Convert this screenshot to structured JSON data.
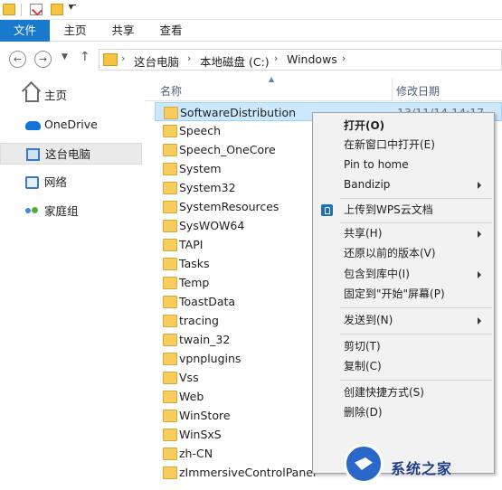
{
  "ribbon": {
    "tabs": [
      {
        "label": "文件"
      },
      {
        "label": "主页"
      },
      {
        "label": "共享"
      },
      {
        "label": "查看"
      }
    ]
  },
  "address": {
    "crumbs": [
      "这台电脑",
      "本地磁盘 (C:)",
      "Windows"
    ]
  },
  "navpane": {
    "items": [
      {
        "label": "主页",
        "icon": "home-icon"
      },
      {
        "label": "OneDrive",
        "icon": "onedrive-icon"
      },
      {
        "label": "这台电脑",
        "icon": "computer-icon",
        "selected": true
      },
      {
        "label": "网络",
        "icon": "network-icon"
      },
      {
        "label": "家庭组",
        "icon": "homegroup-icon"
      }
    ]
  },
  "filelist": {
    "headers": {
      "name": "名称",
      "date": "修改日期"
    },
    "rows": [
      {
        "name": "SoftwareDistribution",
        "date": "13/11/14 14:17",
        "selected": true
      },
      {
        "name": "Speech"
      },
      {
        "name": "Speech_OneCore"
      },
      {
        "name": "System"
      },
      {
        "name": "System32"
      },
      {
        "name": "SystemResources"
      },
      {
        "name": "SysWOW64"
      },
      {
        "name": "TAPI"
      },
      {
        "name": "Tasks"
      },
      {
        "name": "Temp"
      },
      {
        "name": "ToastData"
      },
      {
        "name": "tracing"
      },
      {
        "name": "twain_32"
      },
      {
        "name": "vpnplugins"
      },
      {
        "name": "Vss"
      },
      {
        "name": "Web"
      },
      {
        "name": "WinStore"
      },
      {
        "name": "WinSxS"
      },
      {
        "name": "zh-CN"
      },
      {
        "name": "zImmersiveControlPanel"
      }
    ]
  },
  "contextmenu": {
    "items": [
      {
        "label": "打开(O)",
        "bold": true
      },
      {
        "label": "在新窗口中打开(E)"
      },
      {
        "label": "Pin to home"
      },
      {
        "label": "Bandizip",
        "submenu": true
      },
      {
        "separator": true
      },
      {
        "label": "上传到WPS云文档",
        "icon": "wps-icon"
      },
      {
        "separator": true
      },
      {
        "label": "共享(H)",
        "submenu": true
      },
      {
        "label": "还原以前的版本(V)"
      },
      {
        "label": "包含到库中(I)",
        "submenu": true
      },
      {
        "label": "固定到\"开始\"屏幕(P)"
      },
      {
        "separator": true
      },
      {
        "label": "发送到(N)",
        "submenu": true
      },
      {
        "separator": true
      },
      {
        "label": "剪切(T)"
      },
      {
        "label": "复制(C)"
      },
      {
        "separator": true
      },
      {
        "label": "创建快捷方式(S)"
      },
      {
        "label": "删除(D)",
        "icon": "shield-icon"
      }
    ]
  },
  "watermark": {
    "text": "系统之家"
  },
  "colors": {
    "file_tab": "#1979ca",
    "selection": "#cce8ff",
    "folder": "#f7cd5d"
  }
}
